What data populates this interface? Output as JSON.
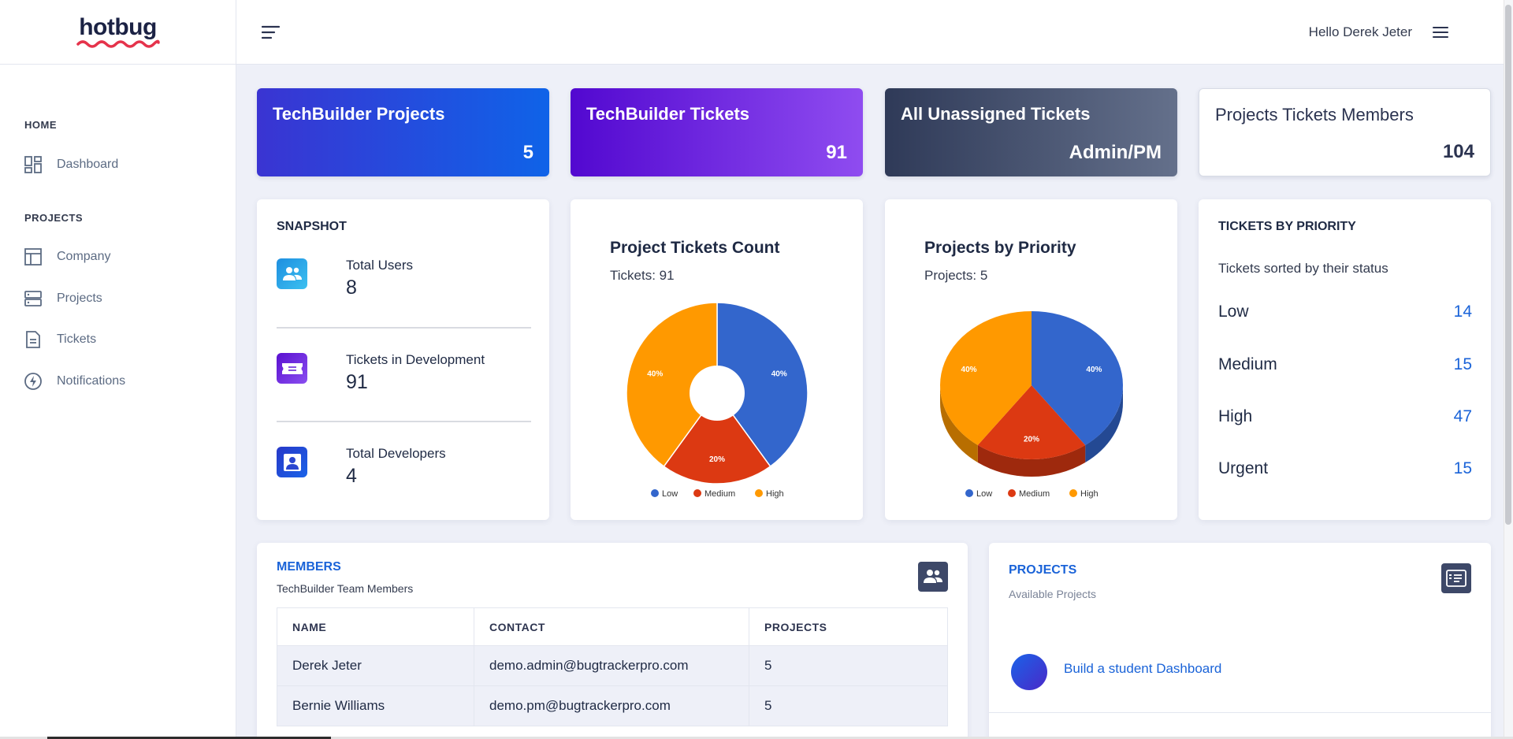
{
  "sidebar": {
    "logo": "hotbug",
    "sections": [
      {
        "title": "HOME",
        "items": [
          {
            "label": "Dashboard",
            "icon": "dashboard-icon"
          }
        ]
      },
      {
        "title": "PROJECTS",
        "items": [
          {
            "label": "Company",
            "icon": "company-icon"
          },
          {
            "label": "Projects",
            "icon": "projects-icon"
          },
          {
            "label": "Tickets",
            "icon": "tickets-icon"
          },
          {
            "label": "Notifications",
            "icon": "notifications-icon"
          }
        ]
      }
    ]
  },
  "header": {
    "greeting": "Hello Derek Jeter"
  },
  "stats": [
    {
      "title": "TechBuilder Projects",
      "value": "5"
    },
    {
      "title": "TechBuilder Tickets",
      "value": "91"
    },
    {
      "title": "All Unassigned Tickets",
      "value": "Admin/PM"
    },
    {
      "title": "Projects Tickets Members",
      "value": "104"
    }
  ],
  "snapshot": {
    "title": "SNAPSHOT",
    "items": [
      {
        "label": "Total Users",
        "value": "8",
        "icon": "users-icon"
      },
      {
        "label": "Tickets in Development",
        "value": "91",
        "icon": "ticket-icon"
      },
      {
        "label": "Total Developers",
        "value": "4",
        "icon": "developer-icon"
      }
    ]
  },
  "chart_data": [
    {
      "type": "pie",
      "title": "Project Tickets Count",
      "subtitle": "Tickets: 91",
      "categories": [
        "Low",
        "Medium",
        "High"
      ],
      "values": [
        40,
        20,
        40
      ],
      "labels": [
        "40%",
        "20%",
        "40%"
      ],
      "colors": [
        "#3366cc",
        "#dc3912",
        "#ff9900"
      ],
      "donut": true,
      "legend": "bottom"
    },
    {
      "type": "pie",
      "title": "Projects by Priority",
      "subtitle": "Projects: 5",
      "categories": [
        "Low",
        "Medium",
        "High"
      ],
      "values": [
        40,
        20,
        40
      ],
      "labels": [
        "40%",
        "20%",
        "40%"
      ],
      "colors": [
        "#3366cc",
        "#dc3912",
        "#ff9900"
      ],
      "three_d": true,
      "legend": "bottom"
    }
  ],
  "tickets_by_priority": {
    "title": "TICKETS BY PRIORITY",
    "subtitle": "Tickets sorted by their status",
    "rows": [
      {
        "label": "Low",
        "count": "14"
      },
      {
        "label": "Medium",
        "count": "15"
      },
      {
        "label": "High",
        "count": "47"
      },
      {
        "label": "Urgent",
        "count": "15"
      }
    ]
  },
  "members": {
    "title": "MEMBERS",
    "subtitle": "TechBuilder Team Members",
    "columns": [
      "NAME",
      "CONTACT",
      "PROJECTS"
    ],
    "rows": [
      [
        "Derek Jeter",
        "demo.admin@bugtrackerpro.com",
        "5"
      ],
      [
        "Bernie Williams",
        "demo.pm@bugtrackerpro.com",
        "5"
      ]
    ]
  },
  "projects": {
    "title": "PROJECTS",
    "subtitle": "Available Projects",
    "items": [
      {
        "name": "Build a student Dashboard"
      }
    ]
  },
  "colors": {
    "accent": "#1a63d8",
    "low": "#3366cc",
    "medium": "#dc3912",
    "high": "#ff9900"
  }
}
